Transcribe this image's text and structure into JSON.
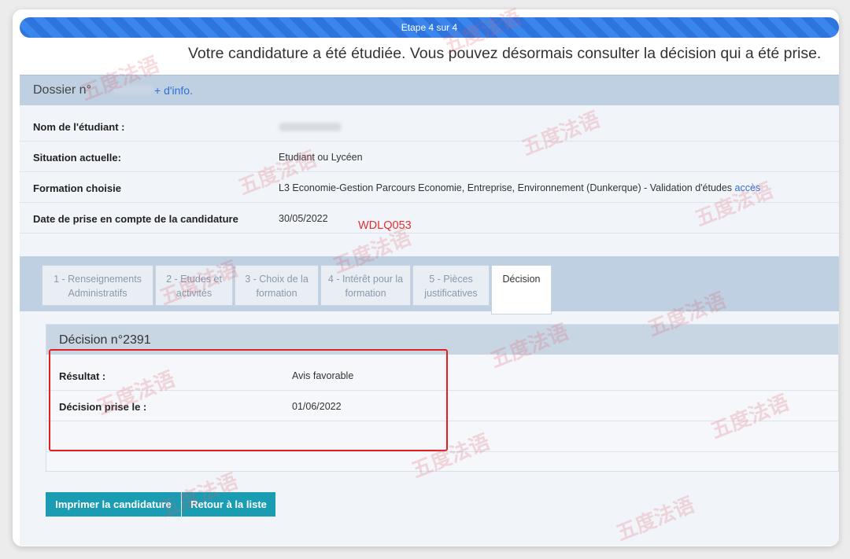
{
  "progress": {
    "label": "Etape 4 sur 4"
  },
  "headline": "Votre candidature a été étudiée. Vous pouvez désormais consulter la décision qui a été prise.",
  "dossier": {
    "label": "Dossier n°",
    "more_link": "+ d'info."
  },
  "fields": [
    {
      "label": "Nom de l'étudiant :",
      "value": ""
    },
    {
      "label": "Situation actuelle:",
      "value": "Etudiant ou Lycéen"
    },
    {
      "label": "Formation choisie",
      "value": "L3 Economie-Gestion Parcours Economie, Entreprise, Environnement (Dunkerque) - Validation d'études",
      "link": "accès"
    },
    {
      "label": "Date de prise en compte de la candidature",
      "value": "30/05/2022"
    }
  ],
  "annotation_code": "WDLQ053",
  "tabs": [
    {
      "label": "1 - Renseignements Administratifs"
    },
    {
      "label": "2 - Etudes et activités"
    },
    {
      "label": "3 - Choix de la formation"
    },
    {
      "label": "4 - Intérêt pour la formation"
    },
    {
      "label": "5 - Pièces justificatives"
    },
    {
      "label": "Décision"
    }
  ],
  "decision": {
    "title": "Décision n°2391",
    "rows": [
      {
        "label": "Résultat :",
        "value": "Avis favorable"
      },
      {
        "label": "Décision prise le :",
        "value": "01/06/2022"
      }
    ]
  },
  "buttons": {
    "print": "Imprimer la candidature",
    "back": "Retour à la liste"
  },
  "watermark": "五度法语",
  "colors": {
    "progress": "#2d74df",
    "panel": "#bed0e1",
    "button": "#1a9db2",
    "link": "#2f6fd6",
    "highlight": "#e02020"
  }
}
